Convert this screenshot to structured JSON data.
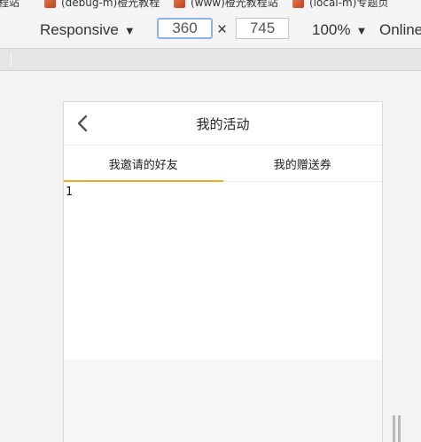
{
  "bookmarks": [
    {
      "label": "程站"
    },
    {
      "label": "(debug-m)橙光教程"
    },
    {
      "label": "(www)橙光教程站"
    },
    {
      "label": "(local-m)专题页"
    }
  ],
  "toolbar": {
    "device_label": "Responsive",
    "width_value": "360",
    "times_symbol": "×",
    "height_value": "745",
    "zoom_label": "100%",
    "network_label": "Online"
  },
  "app": {
    "title": "我的活动",
    "tabs": [
      {
        "label": "我邀请的好友",
        "active": true
      },
      {
        "label": "我的赠送券",
        "active": false
      }
    ],
    "content_text": "1",
    "accent_color": "#f7a623"
  },
  "icons": {
    "back": "chevron-left-icon",
    "dropdown": "caret-down-icon",
    "bookmark": "favicon-icon",
    "resize": "resize-grip-icon"
  }
}
